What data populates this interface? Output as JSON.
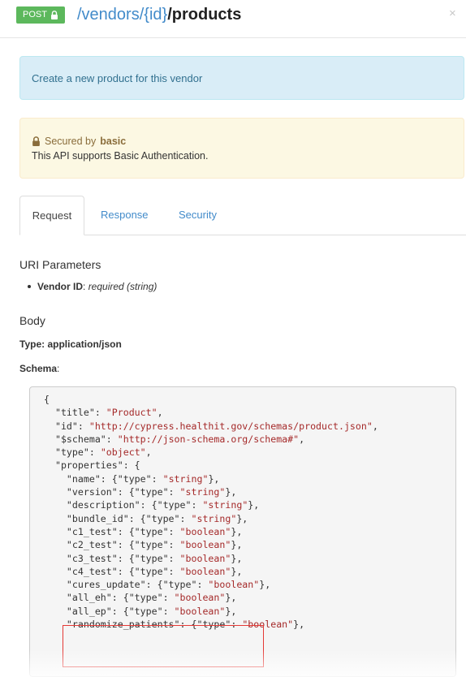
{
  "header": {
    "method": "POST",
    "route_prefix": "/vendors/{id}",
    "route_last": "/products",
    "close_icon": "close-icon"
  },
  "description": "Create a new product for this vendor",
  "security_notice": {
    "secured_by_prefix": "Secured by",
    "scheme": "basic",
    "message": "This API supports Basic Authentication."
  },
  "tabs": [
    {
      "label": "Request",
      "active": true
    },
    {
      "label": "Response",
      "active": false
    },
    {
      "label": "Security",
      "active": false
    }
  ],
  "uri_parameters": {
    "heading": "URI Parameters",
    "param_name": "Vendor ID",
    "param_desc": "required (string)"
  },
  "body": {
    "heading": "Body",
    "type_label": "Type: application/json",
    "schema_label": "Schema"
  },
  "schema_lines": [
    [
      {
        "t": "{",
        "c": "k"
      }
    ],
    [
      {
        "t": "  \"title\": ",
        "c": "k"
      },
      {
        "t": "\"Product\"",
        "c": "s"
      },
      {
        "t": ",",
        "c": "k"
      }
    ],
    [
      {
        "t": "  \"id\": ",
        "c": "k"
      },
      {
        "t": "\"http://cypress.healthit.gov/schemas/product.json\"",
        "c": "s"
      },
      {
        "t": ",",
        "c": "k"
      }
    ],
    [
      {
        "t": "  \"$schema\": ",
        "c": "k"
      },
      {
        "t": "\"http://json-schema.org/schema#\"",
        "c": "s"
      },
      {
        "t": ",",
        "c": "k"
      }
    ],
    [
      {
        "t": "  \"type\": ",
        "c": "k"
      },
      {
        "t": "\"object\"",
        "c": "s"
      },
      {
        "t": ",",
        "c": "k"
      }
    ],
    [
      {
        "t": "  \"properties\": {",
        "c": "k"
      }
    ],
    [
      {
        "t": "    \"name\": {\"type\": ",
        "c": "k"
      },
      {
        "t": "\"string\"",
        "c": "s"
      },
      {
        "t": "},",
        "c": "k"
      }
    ],
    [
      {
        "t": "    \"version\": {\"type\": ",
        "c": "k"
      },
      {
        "t": "\"string\"",
        "c": "s"
      },
      {
        "t": "},",
        "c": "k"
      }
    ],
    [
      {
        "t": "    \"description\": {\"type\": ",
        "c": "k"
      },
      {
        "t": "\"string\"",
        "c": "s"
      },
      {
        "t": "},",
        "c": "k"
      }
    ],
    [
      {
        "t": "    \"bundle_id\": {\"type\": ",
        "c": "k"
      },
      {
        "t": "\"string\"",
        "c": "s"
      },
      {
        "t": "},",
        "c": "k"
      }
    ],
    [
      {
        "t": "    \"c1_test\": {\"type\": ",
        "c": "k"
      },
      {
        "t": "\"boolean\"",
        "c": "s"
      },
      {
        "t": "},",
        "c": "k"
      }
    ],
    [
      {
        "t": "    \"c2_test\": {\"type\": ",
        "c": "k"
      },
      {
        "t": "\"boolean\"",
        "c": "s"
      },
      {
        "t": "},",
        "c": "k"
      }
    ],
    [
      {
        "t": "    \"c3_test\": {\"type\": ",
        "c": "k"
      },
      {
        "t": "\"boolean\"",
        "c": "s"
      },
      {
        "t": "},",
        "c": "k"
      }
    ],
    [
      {
        "t": "    \"c4_test\": {\"type\": ",
        "c": "k"
      },
      {
        "t": "\"boolean\"",
        "c": "s"
      },
      {
        "t": "},",
        "c": "k"
      }
    ],
    [
      {
        "t": "    \"cures_update\": {\"type\": ",
        "c": "k"
      },
      {
        "t": "\"boolean\"",
        "c": "s"
      },
      {
        "t": "},",
        "c": "k"
      }
    ],
    [
      {
        "t": "    \"all_eh\": {\"type\": ",
        "c": "k"
      },
      {
        "t": "\"boolean\"",
        "c": "s"
      },
      {
        "t": "},",
        "c": "k"
      }
    ],
    [
      {
        "t": "    \"all_ep\": {\"type\": ",
        "c": "k"
      },
      {
        "t": "\"boolean\"",
        "c": "s"
      },
      {
        "t": "},",
        "c": "k"
      }
    ],
    [
      {
        "t": "    \"randomize_patients\": {\"type\": ",
        "c": "k"
      },
      {
        "t": "\"boolean\"",
        "c": "s"
      },
      {
        "t": "},",
        "c": "k"
      }
    ]
  ],
  "colors": {
    "method_badge": "#5cb85c",
    "link": "#428bca",
    "string_literal": "#a52a2a",
    "highlight_box": "#e53935"
  }
}
